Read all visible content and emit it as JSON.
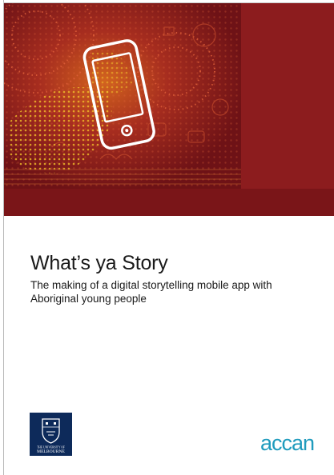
{
  "cover": {
    "title": "What’s ya Story",
    "subtitle": "The making of a digital storytelling mobile app with Aboriginal young people"
  },
  "logos": {
    "university": {
      "line1": "THE UNIVERSITY OF",
      "line2": "MELBOURNE"
    },
    "partner": {
      "text": "accan",
      "color": "#1f9bbd"
    }
  },
  "colors": {
    "banner": "#8c1c1e",
    "banner_strip": "#7a1518",
    "university_navy": "#0d2a5a"
  },
  "icons": [
    "smartphone-icon",
    "university-crest-icon"
  ]
}
